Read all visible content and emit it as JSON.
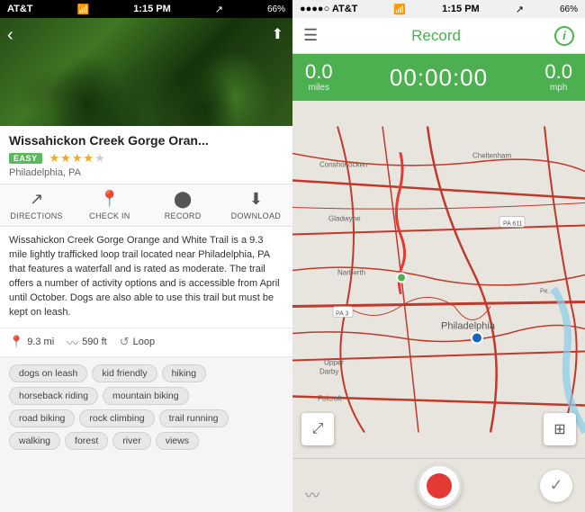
{
  "left": {
    "status": {
      "carrier": "AT&T",
      "wifi": "WiFi",
      "time": "1:15 PM",
      "battery": "66%"
    },
    "trail": {
      "name": "Wissahickon Creek Gorge Oran...",
      "difficulty": "EASY",
      "stars_full": "★★★★",
      "stars_half": "½",
      "location": "Philadelphia, PA"
    },
    "actions": [
      {
        "icon": "↗",
        "label": "DIRECTIONS"
      },
      {
        "icon": "📍",
        "label": "CHECK IN"
      },
      {
        "icon": "⏺",
        "label": "RECORD"
      },
      {
        "icon": "⬇",
        "label": "DOWNLOAD"
      }
    ],
    "description": "Wissahickon Creek Gorge Orange and White Trail is a 9.3 mile lightly trafficked loop trail located near Philadelphia, PA that features a waterfall and is rated as moderate. The trail offers a number of activity options and is accessible from April until October. Dogs are also able to use this trail but must be kept on leash.",
    "stats": {
      "distance": "9.3 mi",
      "elevation": "590 ft",
      "type": "Loop"
    },
    "tags": [
      [
        "dogs on leash",
        "kid friendly",
        "hiking"
      ],
      [
        "horseback riding",
        "mountain biking"
      ],
      [
        "road biking",
        "rock climbing",
        "trail running"
      ],
      [
        "walking",
        "forest",
        "river",
        "views"
      ]
    ]
  },
  "right": {
    "status": {
      "carrier": "AT&T",
      "wifi": "WiFi",
      "time": "1:15 PM",
      "battery": "66%"
    },
    "header": {
      "title": "Record",
      "info_label": "i"
    },
    "stats": {
      "left_value": "0.0",
      "left_unit": "miles",
      "timer": "00:00:00",
      "right_value": "0.0",
      "right_unit": "mph"
    }
  }
}
